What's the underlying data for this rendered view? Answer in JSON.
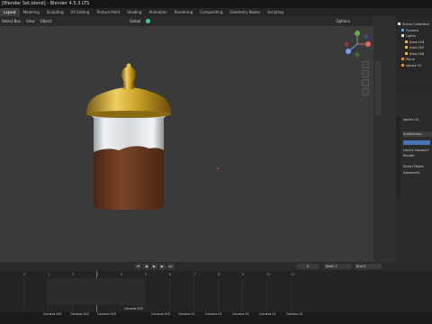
{
  "window": {
    "title": "[Blender Set.blend] - Blender 4.5.3 LTS"
  },
  "workspace_tabs": [
    {
      "label": "Layout",
      "active": true
    },
    {
      "label": "Modeling"
    },
    {
      "label": "Sculpting"
    },
    {
      "label": "UV Editing"
    },
    {
      "label": "Texture Paint"
    },
    {
      "label": "Shading"
    },
    {
      "label": "Animation"
    },
    {
      "label": "Rendering"
    },
    {
      "label": "Compositing"
    },
    {
      "label": "Geometry Nodes"
    },
    {
      "label": "Scripting"
    }
  ],
  "header": {
    "menu_items": [
      "Select Box",
      "View",
      "Object"
    ],
    "transform_orientation": "Global",
    "options_label": "Options"
  },
  "viewport": {
    "colors": {
      "background": "#3a3a3a",
      "gold": "#c9a227",
      "coffee": "#6b3a21",
      "glass": "#d9dde0"
    }
  },
  "outliner": {
    "title": "Scene Collection",
    "rows": [
      {
        "label": "Scene Collection",
        "icon": "collection-icon"
      },
      {
        "label": "Camera",
        "icon": "camera-icon"
      },
      {
        "label": "Lights",
        "icon": "collection-icon"
      },
      {
        "label": "Area.004",
        "icon": "light-icon"
      },
      {
        "label": "Area.005",
        "icon": "light-icon"
      },
      {
        "label": "Area.006",
        "icon": "light-icon"
      },
      {
        "label": "Plane",
        "icon": "mesh-icon"
      },
      {
        "label": "spices 03",
        "icon": "mesh-icon"
      }
    ]
  },
  "properties": {
    "object_name": "spices 03",
    "panel_label": "Subdivision",
    "labels": [
      "Levels Viewport",
      "Render",
      "Sharp Edges",
      "Advanced"
    ]
  },
  "timeline": {
    "playback_label": "Playback",
    "current_frame": "0",
    "start_label": "Start",
    "start_value": "1",
    "end_label": "End",
    "end_value": "0",
    "ticks": [
      "0",
      "1",
      "2",
      "3",
      "4",
      "5",
      "6",
      "7",
      "8",
      "9",
      "10",
      "11"
    ],
    "markers": [
      "Camera 001",
      "Camera 002",
      "Camera 003",
      "Camera.003",
      "Camera.005",
      "Camera 01",
      "Camera 01",
      "Camera 01",
      "Camera 01",
      "Camera 01"
    ]
  }
}
